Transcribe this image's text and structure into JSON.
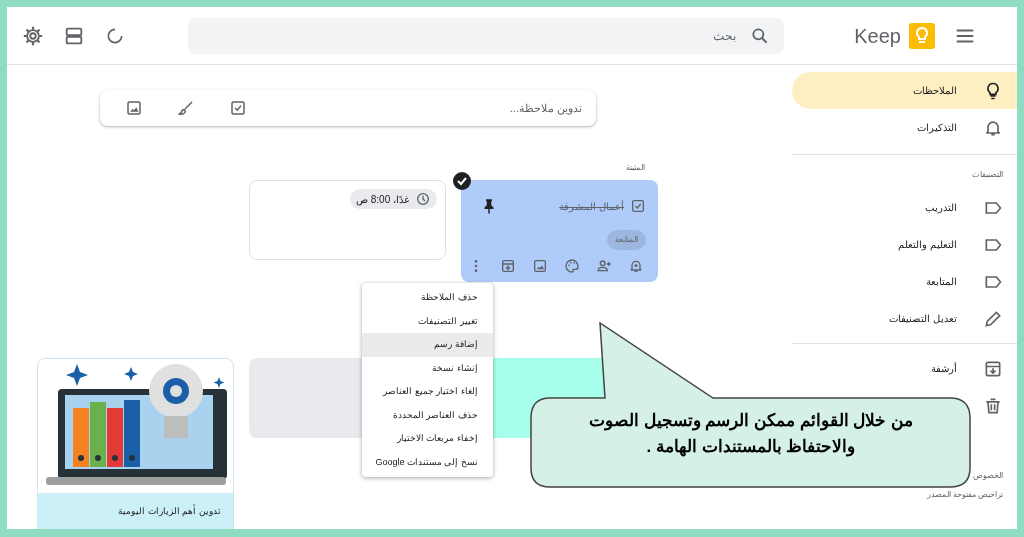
{
  "header": {
    "app_name": "Keep",
    "search": {
      "placeholder": "بحث"
    }
  },
  "sidebar": {
    "nav": [
      {
        "label": "الملاحظات",
        "selected": true
      },
      {
        "label": "التذكيرات",
        "selected": false
      }
    ],
    "labels_heading": "التصنيفات",
    "labels": [
      {
        "kind": "label",
        "label": "التدريب",
        "selected": false
      },
      {
        "kind": "label",
        "label": "التعليم والتعلم",
        "selected": false
      },
      {
        "kind": "label",
        "label": "المتابعة",
        "selected": false
      },
      {
        "kind": "edit",
        "label": "تعديل التصنيفات",
        "selected": false
      }
    ],
    "more": [
      {
        "label": "أرشفة",
        "selected": false
      },
      {
        "selected": false
      }
    ],
    "footer": [
      "الخصوص",
      "تراخيص مفتوحة المصدر"
    ]
  },
  "take_note": {
    "placeholder": "تدوين ملاحظة..."
  },
  "pinned": {
    "heading": "المثبتة",
    "notes": [
      {
        "kind": "checklist",
        "color": "#aecbfa",
        "selected": true,
        "items": [
          {
            "text": "أعمال المشرفة",
            "checked": true
          }
        ],
        "label": "المتابعة"
      },
      {
        "kind": "reminder",
        "color": "#ffffff",
        "selected": false,
        "reminder": "غدًا، 8:00 ص"
      }
    ]
  },
  "others": {
    "notes": [
      {
        "kind": "blank",
        "color": "#a7ffeb"
      },
      {
        "kind": "blank",
        "color": "#e8eaed"
      },
      {
        "kind": "image",
        "color": "#cbf0f8",
        "text": "تدوين أهم الزيارات اليومية"
      }
    ]
  },
  "menu": {
    "items": [
      {
        "label": "حذف الملاحظة",
        "selected": false
      },
      {
        "label": "تغيير التصنيفات",
        "selected": false
      },
      {
        "label": "إضافة رسم",
        "selected": true
      },
      {
        "label": "إنشاء نسخة",
        "selected": false
      },
      {
        "label": "إلغاء اختيار جميع العناصر",
        "selected": false
      },
      {
        "label": "حذف العناصر المحددة",
        "selected": false
      },
      {
        "label": "إخفاء مربعات الاختيار",
        "selected": false
      },
      {
        "label": "نسخ إلى مستندات Google",
        "selected": false
      }
    ]
  },
  "callout": {
    "text": "من خلال القوائم ممكن الرسم وتسجيل الصوت والاحتفاظ بالمستندات الهامة ."
  }
}
